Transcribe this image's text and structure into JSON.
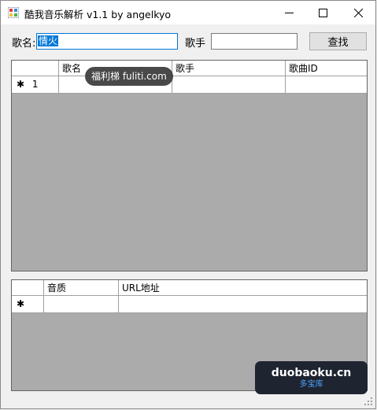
{
  "window": {
    "title": "酷我音乐解析 v1.1 by angelkyo"
  },
  "search": {
    "song_label": "歌名:",
    "song_value": "情火",
    "artist_label": "歌手",
    "artist_value": "",
    "search_button": "查找"
  },
  "results_grid": {
    "columns": [
      "歌名",
      "歌手",
      "歌曲ID"
    ],
    "rows": [
      {
        "marker": "✱",
        "index": "1"
      }
    ]
  },
  "url_grid": {
    "columns": [
      "音质",
      "URL地址"
    ],
    "rows": [
      {
        "marker": "✱"
      }
    ]
  },
  "watermarks": {
    "overlay1": "福利梯 fuliti.com",
    "overlay2_line1": "duobaoku.cn",
    "overlay2_line2": "多宝库"
  },
  "icons": {
    "app": "app-icon",
    "minimize": "minimize-icon",
    "maximize": "maximize-icon",
    "close": "close-icon"
  }
}
